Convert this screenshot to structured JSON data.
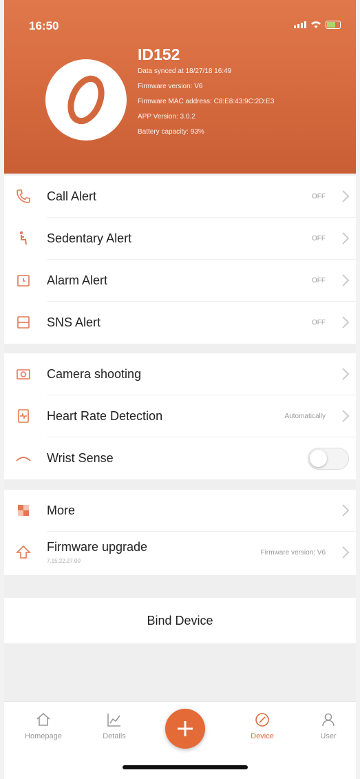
{
  "status": {
    "time": "16:50"
  },
  "device": {
    "name": "ID152",
    "info": [
      "Data synced at 18/27/18 16:49",
      "Firmware version: V6",
      "Firmware MAC address: C8:E8:43:9C:2D:E3",
      "APP Version: 3.0.2",
      "Battery capacity: 93%"
    ]
  },
  "alerts": [
    {
      "label": "Call Alert",
      "value": "OFF",
      "icon": "phone-icon"
    },
    {
      "label": "Sedentary Alert",
      "value": "OFF",
      "icon": "sedentary-icon"
    },
    {
      "label": "Alarm Alert",
      "value": "OFF",
      "icon": "alarm-icon"
    },
    {
      "label": "SNS Alert",
      "value": "OFF",
      "icon": "message-icon"
    }
  ],
  "features": [
    {
      "label": "Camera shooting",
      "value": "",
      "icon": "camera-icon"
    },
    {
      "label": "Heart Rate Detection",
      "value": "Automatically",
      "icon": "heart-rate-icon"
    },
    {
      "label": "Wrist Sense",
      "value": "",
      "icon": "wrist-icon",
      "toggle": "off"
    }
  ],
  "more": [
    {
      "label": "More",
      "value": "",
      "icon": "more-icon"
    },
    {
      "label": "Firmware upgrade",
      "sub": "7.15.22.27.00",
      "value": "Firmware version: V6",
      "icon": "upgrade-icon"
    }
  ],
  "bind_label": "Bind Device",
  "tabs": [
    {
      "label": "Homepage",
      "icon": "home-icon"
    },
    {
      "label": "Details",
      "icon": "chart-icon"
    },
    {
      "label": "Device",
      "icon": "watch-icon",
      "active": true
    },
    {
      "label": "User",
      "icon": "user-icon"
    }
  ],
  "colors": {
    "accent": "#e06b3f",
    "header": "#d86c40"
  }
}
